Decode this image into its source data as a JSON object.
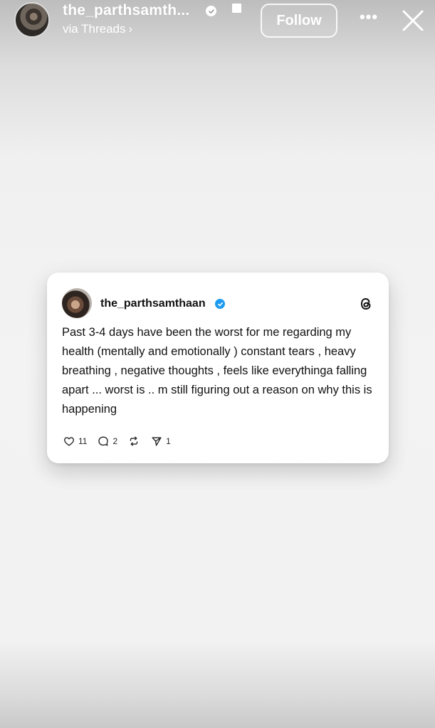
{
  "header": {
    "username": "the_parthsamth...",
    "subline": "via Threads",
    "subline_chevron": "›",
    "follow_label": "Follow",
    "more_label": "•••",
    "icons": {
      "verified": "verified-badge-icon",
      "close": "close-icon",
      "more": "more-options-icon"
    }
  },
  "post": {
    "username": "the_parthsamthaan",
    "verified": true,
    "text": "Past 3-4 days have been the worst for me regarding my health (mentally and emotionally ) constant tears , heavy breathing , negative thoughts , feels like everythinga falling apart ... worst is .. m still figuring out a reason on why this is happening",
    "likes": "11",
    "replies": "2",
    "shares": "1",
    "icons": [
      "heart-icon",
      "comment-icon",
      "repost-icon",
      "send-icon",
      "threads-logo-icon"
    ]
  },
  "colors": {
    "card_bg": "#ffffff",
    "verified_blue": "#1d9bf0",
    "text": "#111111"
  }
}
